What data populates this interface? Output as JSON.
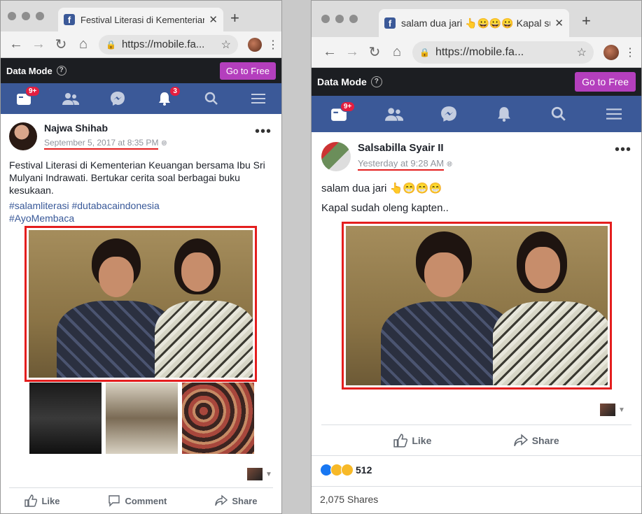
{
  "left": {
    "tab_title": "Festival Literasi di Kementerian Keuangan bersama Ibu Sri",
    "url": "https://mobile.fa...",
    "data_mode_label": "Data Mode",
    "go_free_label": "Go to Free",
    "badges": {
      "friends_requests": "9+",
      "notifications": "3"
    },
    "post": {
      "author": "Najwa Shihab",
      "date": "September 5, 2017 at 8:35 PM",
      "text": "Festival Literasi di Kementerian Keuangan bersama Ibu Sri Mulyani Indrawati. Bertukar cerita soal berbagai buku kesukaan.",
      "hashtags_line1": "#salamliterasi #dutabacaindonesia",
      "hashtags_line2": "#AyoMembaca"
    },
    "actions": {
      "like": "Like",
      "comment": "Comment",
      "share": "Share"
    }
  },
  "right": {
    "tab_title": "salam dua jari 👆😀😀😀 Kapal sudah oleng kapten..",
    "url": "https://mobile.fa...",
    "data_mode_label": "Data Mode",
    "go_free_label": "Go to Free",
    "badges": {
      "friends_requests": "9+"
    },
    "post": {
      "author": "Salsabilla Syair II",
      "date": "Yesterday at 9:28 AM",
      "line1": "salam dua jari 👆😁😁😁",
      "line2": "Kapal sudah oleng kapten.."
    },
    "actions": {
      "like": "Like",
      "share": "Share"
    },
    "reaction_count": "512",
    "shares_text": "2,075 Shares"
  },
  "colors": {
    "fb_blue": "#3b5998",
    "highlight_red": "#e41e1e",
    "go_free_purple": "#b43fbd",
    "badge_red": "#e41e3f"
  }
}
